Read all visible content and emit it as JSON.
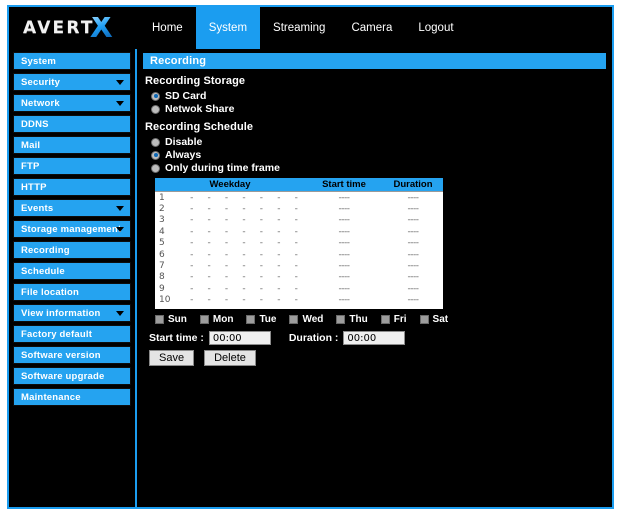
{
  "brand": {
    "name": "AVERT",
    "accent_letter": "X",
    "accent_color": "#1b9df0"
  },
  "nav": {
    "items": [
      {
        "label": "Home",
        "active": false
      },
      {
        "label": "System",
        "active": true
      },
      {
        "label": "Streaming",
        "active": false
      },
      {
        "label": "Camera",
        "active": false
      },
      {
        "label": "Logout",
        "active": false
      }
    ]
  },
  "sidebar": {
    "items": [
      {
        "label": "System",
        "caret": false
      },
      {
        "label": "Security",
        "caret": true
      },
      {
        "label": "Network",
        "caret": true
      },
      {
        "label": "DDNS",
        "caret": false
      },
      {
        "label": "Mail",
        "caret": false
      },
      {
        "label": "FTP",
        "caret": false
      },
      {
        "label": "HTTP",
        "caret": false
      },
      {
        "label": "Events",
        "caret": true
      },
      {
        "label": "Storage management",
        "caret": true
      },
      {
        "label": "Recording",
        "caret": false
      },
      {
        "label": "Schedule",
        "caret": false
      },
      {
        "label": "File location",
        "caret": false
      },
      {
        "label": "View information",
        "caret": true
      },
      {
        "label": "Factory default",
        "caret": false
      },
      {
        "label": "Software version",
        "caret": false
      },
      {
        "label": "Software upgrade",
        "caret": false
      },
      {
        "label": "Maintenance",
        "caret": false
      }
    ]
  },
  "main": {
    "panel_title": "Recording",
    "storage": {
      "heading": "Recording Storage",
      "options": [
        {
          "label": "SD Card",
          "checked": true
        },
        {
          "label": "Netwok Share",
          "checked": false
        }
      ]
    },
    "schedule": {
      "heading": "Recording Schedule",
      "options": [
        {
          "label": "Disable",
          "checked": false
        },
        {
          "label": "Always",
          "checked": true
        },
        {
          "label": "Only during time frame",
          "checked": false
        }
      ],
      "table": {
        "columns": [
          "Weekday",
          "Start time",
          "Duration"
        ],
        "day_placeholder": "-",
        "day_count": 7,
        "rows": [
          {
            "index": "1",
            "start": "----",
            "duration": "----"
          },
          {
            "index": "2",
            "start": "----",
            "duration": "----"
          },
          {
            "index": "3",
            "start": "----",
            "duration": "----"
          },
          {
            "index": "4",
            "start": "----",
            "duration": "----"
          },
          {
            "index": "5",
            "start": "----",
            "duration": "----"
          },
          {
            "index": "6",
            "start": "----",
            "duration": "----"
          },
          {
            "index": "7",
            "start": "----",
            "duration": "----"
          },
          {
            "index": "8",
            "start": "----",
            "duration": "----"
          },
          {
            "index": "9",
            "start": "----",
            "duration": "----"
          },
          {
            "index": "10",
            "start": "----",
            "duration": "----"
          }
        ]
      },
      "weekdays": [
        {
          "label": "Sun",
          "checked": false
        },
        {
          "label": "Mon",
          "checked": false
        },
        {
          "label": "Tue",
          "checked": false
        },
        {
          "label": "Wed",
          "checked": false
        },
        {
          "label": "Thu",
          "checked": false
        },
        {
          "label": "Fri",
          "checked": false
        },
        {
          "label": "Sat",
          "checked": false
        }
      ],
      "start_time_label": "Start time :",
      "start_time_value": "00:00",
      "duration_label": "Duration :",
      "duration_value": "00:00",
      "save_label": "Save",
      "delete_label": "Delete"
    }
  }
}
